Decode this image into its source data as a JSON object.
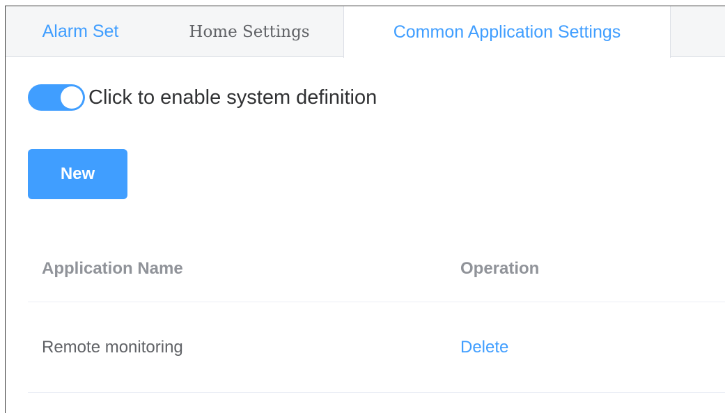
{
  "tabs": {
    "alarm_set": "Alarm Set",
    "home_settings": "Home Settings",
    "common_app_settings": "Common Application Settings",
    "active": "common_app_settings"
  },
  "toggle": {
    "label": "Click to enable system definition",
    "on": true
  },
  "toolbar": {
    "new_label": "New"
  },
  "table": {
    "headers": [
      "Application Name",
      "Operation"
    ],
    "rows": [
      {
        "name": "Remote monitoring",
        "action": "Delete"
      }
    ]
  },
  "colors": {
    "accent": "#409eff",
    "text": "#303133",
    "muted": "#909399"
  }
}
